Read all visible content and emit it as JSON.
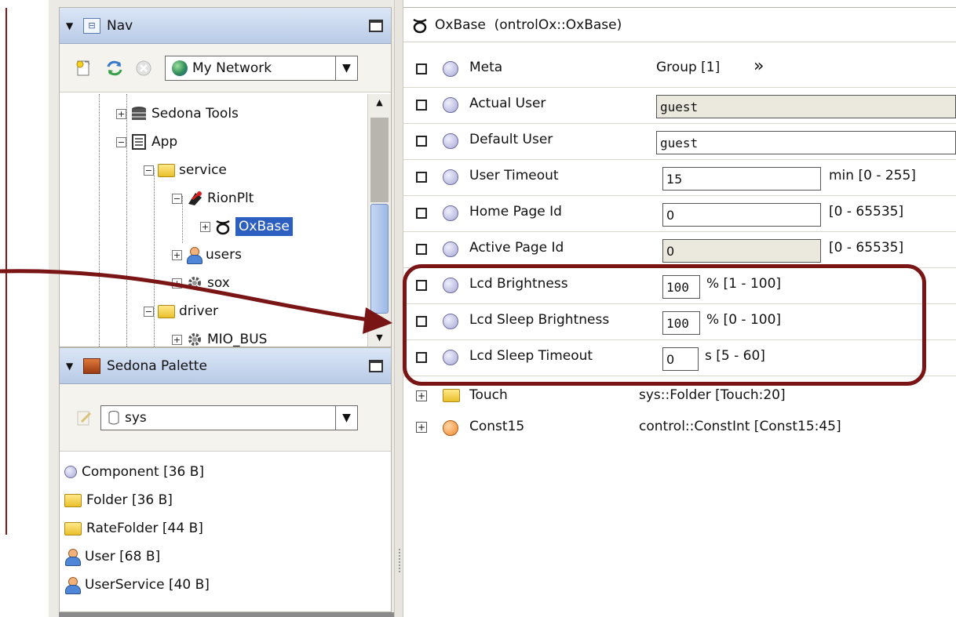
{
  "nav": {
    "title": "Nav",
    "network": "My Network",
    "tree": [
      {
        "label": "Sedona Tools",
        "icon": "database-icon"
      },
      {
        "label": "App",
        "icon": "app-icon"
      },
      {
        "label": "service",
        "icon": "folder-icon"
      },
      {
        "label": "RionPlt",
        "icon": "platform-icon"
      },
      {
        "label": "OxBase",
        "icon": "oxbase-icon"
      },
      {
        "label": "users",
        "icon": "user-icon"
      },
      {
        "label": "sox",
        "icon": "gear-icon"
      },
      {
        "label": "driver",
        "icon": "folder-icon"
      },
      {
        "label": "MIO_BUS",
        "icon": "gear-icon"
      }
    ]
  },
  "palette": {
    "title": "Sedona Palette",
    "kit": "sys",
    "items": [
      {
        "label": "Component [36 B]",
        "icon": "component-icon"
      },
      {
        "label": "Folder [36 B]",
        "icon": "folder-icon"
      },
      {
        "label": "RateFolder [44 B]",
        "icon": "folder-icon"
      },
      {
        "label": "User [68 B]",
        "icon": "user-icon"
      },
      {
        "label": "UserService [40 B]",
        "icon": "user-icon"
      }
    ]
  },
  "sheet": {
    "header": "OxBase  (ontrolOx::OxBase)",
    "meta": {
      "name": "Meta",
      "value": "Group [1]",
      "more": "»"
    },
    "actual_user": {
      "name": "Actual User",
      "value": "guest"
    },
    "default_user": {
      "name": "Default User",
      "value": "guest"
    },
    "user_timeout": {
      "name": "User Timeout",
      "value": "15",
      "unit": "min [0 - 255]"
    },
    "home_page": {
      "name": "Home Page Id",
      "value": "0",
      "unit": "[0 - 65535]"
    },
    "active_page": {
      "name": "Active Page Id",
      "value": "0",
      "unit": "[0 - 65535]"
    },
    "lcd_brightness": {
      "name": "Lcd Brightness",
      "value": "100",
      "unit": "% [1 - 100]"
    },
    "lcd_sleep_brightness": {
      "name": "Lcd Sleep Brightness",
      "value": "100",
      "unit": "% [0 - 100]"
    },
    "lcd_sleep_timeout": {
      "name": "Lcd Sleep Timeout",
      "value": "0",
      "unit": "s [5 - 60]"
    },
    "touch": {
      "name": "Touch",
      "value": "sys::Folder [Touch:20]"
    },
    "const15": {
      "name": "Const15",
      "value": "control::ConstInt [Const15:45]"
    }
  },
  "colors": {
    "annotation": "#7a1515",
    "selection": "#2c5fbf"
  }
}
